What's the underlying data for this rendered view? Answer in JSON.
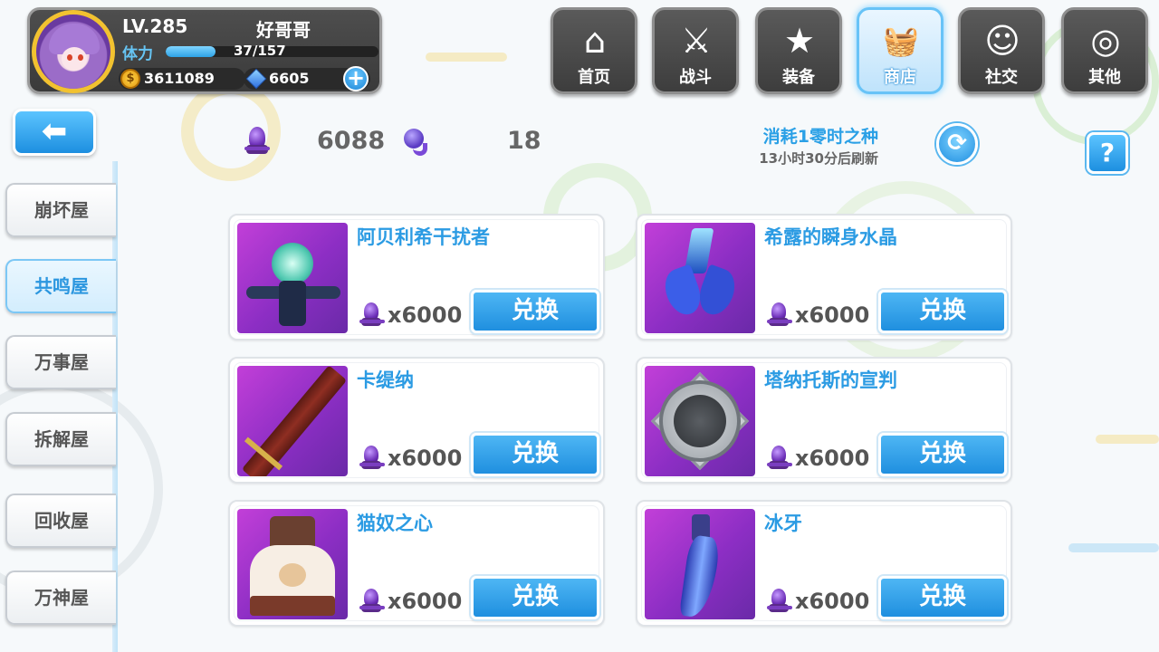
{
  "player": {
    "level": "LV.285",
    "name": "好哥哥",
    "stamina_label": "体力",
    "stamina_text": "37/157",
    "stamina_fraction": 0.236,
    "gold": "3611089",
    "gems": "6605",
    "add_icon": "plus-icon"
  },
  "nav": {
    "items": [
      {
        "label": "首页",
        "icon": "house-icon",
        "glyph": "⌂"
      },
      {
        "label": "战斗",
        "icon": "swords-icon",
        "glyph": "⚔"
      },
      {
        "label": "装备",
        "icon": "gun-star-icon",
        "glyph": "★"
      },
      {
        "label": "商店",
        "icon": "basket-icon",
        "glyph": "🛒",
        "active": true
      },
      {
        "label": "社交",
        "icon": "face-icon",
        "glyph": "☺"
      },
      {
        "label": "其他",
        "icon": "snail-icon",
        "glyph": "◎"
      }
    ]
  },
  "back_icon": "left-arrow-icon",
  "sidebar": {
    "items": [
      {
        "label": "崩坏屋"
      },
      {
        "label": "共鸣屋",
        "active": true
      },
      {
        "label": "万事屋"
      },
      {
        "label": "拆解屋"
      },
      {
        "label": "回收屋"
      },
      {
        "label": "万神屋"
      }
    ]
  },
  "currency_row": {
    "crystal_count": "6088",
    "seed_count": "18",
    "refresh_cost": "消耗1零时之种",
    "refresh_timer": "13小时30分后刷新",
    "refresh_icon": "refresh-icon",
    "help_label": "?"
  },
  "shop": {
    "exchange_label": "兑换",
    "items": [
      {
        "name": "阿贝利希干扰者",
        "price": "x6000"
      },
      {
        "name": "希露的瞬身水晶",
        "price": "x6000"
      },
      {
        "name": "卡缇纳",
        "price": "x6000"
      },
      {
        "name": "塔纳托斯的宣判",
        "price": "x6000"
      },
      {
        "name": "猫奴之心",
        "price": "x6000"
      },
      {
        "name": "冰牙",
        "price": "x6000"
      }
    ]
  },
  "colors": {
    "accent": "#2b9be3",
    "item_bg": "#8c2ec4",
    "nav_bg": "#454545"
  }
}
